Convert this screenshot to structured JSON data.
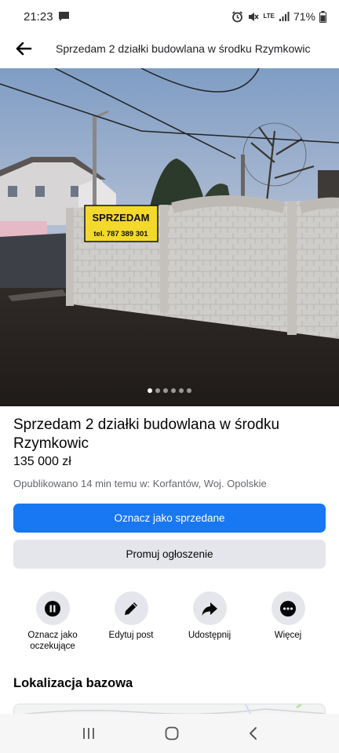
{
  "status_bar": {
    "time": "21:23",
    "network": "LTE",
    "battery": "71%"
  },
  "header": {
    "title": "Sprzedam 2 działki budowlana w środku Rzymkowic"
  },
  "photo": {
    "sign_text": "SPRZEDAM",
    "sign_phone": "tel. 787 389 301",
    "dot_count": 6,
    "active_dot": 0
  },
  "listing": {
    "title": "Sprzedam 2 działki budowlana w środku Rzymkowic",
    "price": "135 000 zł",
    "meta": "Opublikowano 14 min temu w: Korfantów, Woj. Opolskie"
  },
  "buttons": {
    "mark_sold": "Oznacz jako sprzedane",
    "promote": "Promuj ogłoszenie"
  },
  "actions": [
    {
      "label": "Oznacz jako oczekujące",
      "icon": "pause-icon"
    },
    {
      "label": "Edytuj post",
      "icon": "pencil-icon"
    },
    {
      "label": "Udostępnij",
      "icon": "share-icon"
    },
    {
      "label": "Więcej",
      "icon": "more-icon"
    }
  ],
  "location": {
    "section_title": "Lokalizacja bazowa"
  },
  "colors": {
    "primary": "#1877f2",
    "secondary_button": "#e4e6eb",
    "meta_text": "#65676b"
  }
}
